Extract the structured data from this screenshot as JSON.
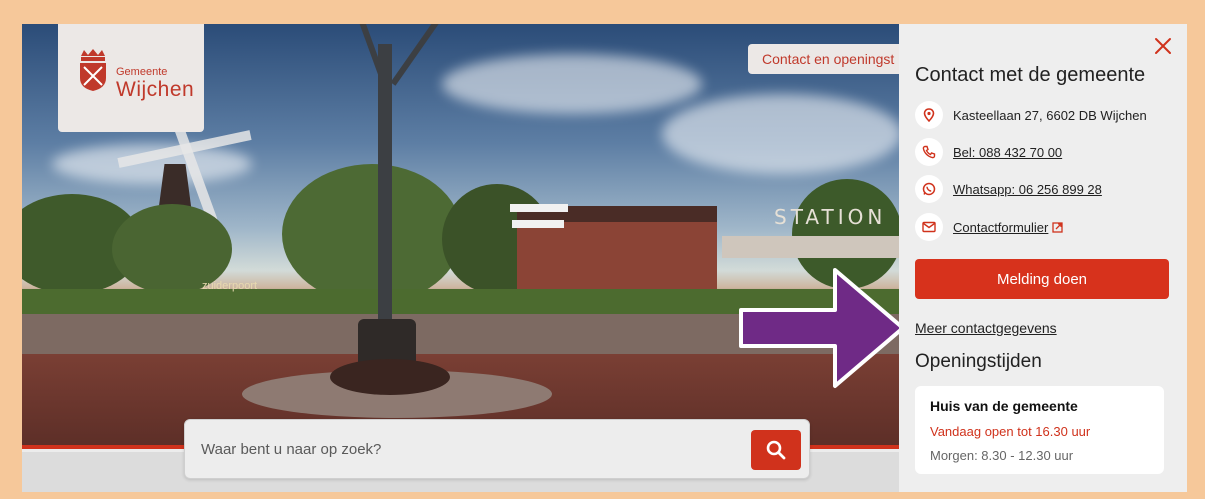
{
  "logo": {
    "top_text": "Gemeente",
    "main_text": "Wijchen"
  },
  "header": {
    "contact_link": "Contact en openingst"
  },
  "hero": {
    "station_sign": "STATION",
    "mill_sign": "zuiderpoort"
  },
  "search": {
    "placeholder": "Waar bent u naar op zoek?"
  },
  "panel": {
    "title": "Contact met de gemeente",
    "address": "Kasteellaan 27, 6602 DB Wijchen",
    "phone": "Bel: 088 432 70 00",
    "whatsapp": "Whatsapp: 06 256 899 28",
    "contact_form": "Contactformulier",
    "report_button": "Melding doen",
    "more_contact": "Meer contactgegevens",
    "opening_title": "Openingstijden",
    "card": {
      "title": "Huis van de gemeente",
      "today": "Vandaag open tot 16.30 uur",
      "tomorrow": "Morgen: 8.30 - 12.30 uur"
    }
  },
  "colors": {
    "brand": "#d0321c",
    "frame": "#f6c89a",
    "arrow": "#6f2a86"
  }
}
